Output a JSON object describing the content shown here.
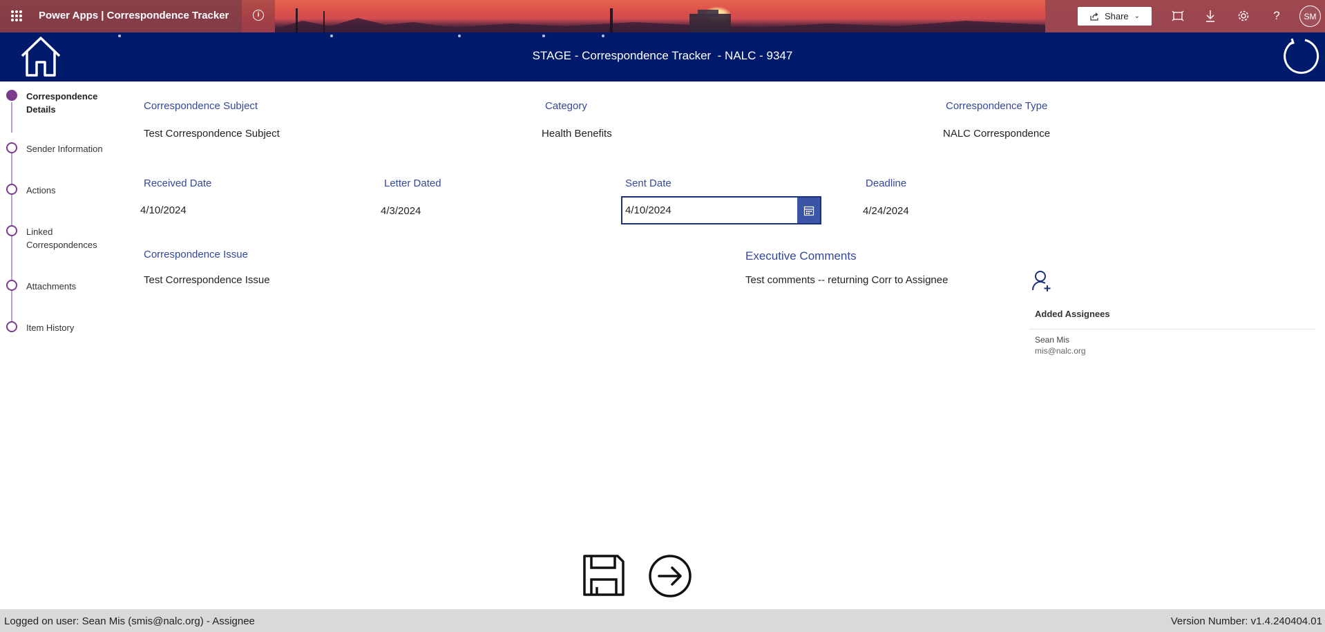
{
  "topbar": {
    "app_title": "Power Apps  |  Correspondence Tracker",
    "share_label": "Share",
    "avatar_initials": "SM"
  },
  "header": {
    "title": "STAGE - Correspondence Tracker  - NALC - 9347"
  },
  "stepper": {
    "steps": [
      {
        "label": "Correspondence Details",
        "active": true
      },
      {
        "label": "Sender Information",
        "active": false
      },
      {
        "label": "Actions",
        "active": false
      },
      {
        "label": "Linked Correspondences",
        "active": false
      },
      {
        "label": "Attachments",
        "active": false
      },
      {
        "label": "Item History",
        "active": false
      }
    ]
  },
  "form": {
    "subject": {
      "label": "Correspondence Subject",
      "value": "Test Correspondence Subject"
    },
    "category": {
      "label": "Category",
      "value": "Health Benefits"
    },
    "type": {
      "label": "Correspondence Type",
      "value": "NALC Correspondence"
    },
    "received_date": {
      "label": "Received Date",
      "value": "4/10/2024"
    },
    "letter_dated": {
      "label": "Letter Dated",
      "value": "4/3/2024"
    },
    "sent_date": {
      "label": "Sent Date",
      "value": "4/10/2024"
    },
    "deadline": {
      "label": "Deadline",
      "value": "4/24/2024"
    },
    "issue": {
      "label": "Correspondence Issue",
      "value": "Test Correspondence Issue"
    },
    "exec_comments": {
      "label": "Executive Comments",
      "value": "Test comments -- returning Corr to Assignee"
    }
  },
  "assignees": {
    "title": "Added Assignees",
    "items": [
      {
        "name": "Sean Mis",
        "email": "mis@nalc.org"
      }
    ]
  },
  "footer": {
    "logged_on": "Logged on user: Sean Mis (smis@nalc.org) - Assignee",
    "version": "Version Number: v1.4.240404.01"
  },
  "icons": {
    "waffle": "app-launcher-icon",
    "info": "info-icon",
    "home": "home-icon",
    "refresh": "refresh-icon",
    "calendar": "calendar-icon",
    "add_user": "add-user-icon",
    "save": "save-icon",
    "next": "arrow-right-circle-icon"
  },
  "colors": {
    "header_bg": "#001a6b",
    "label_blue": "#34479a",
    "stepper_purple": "#7b3a8c",
    "footer_bg": "#d9d9d9"
  }
}
